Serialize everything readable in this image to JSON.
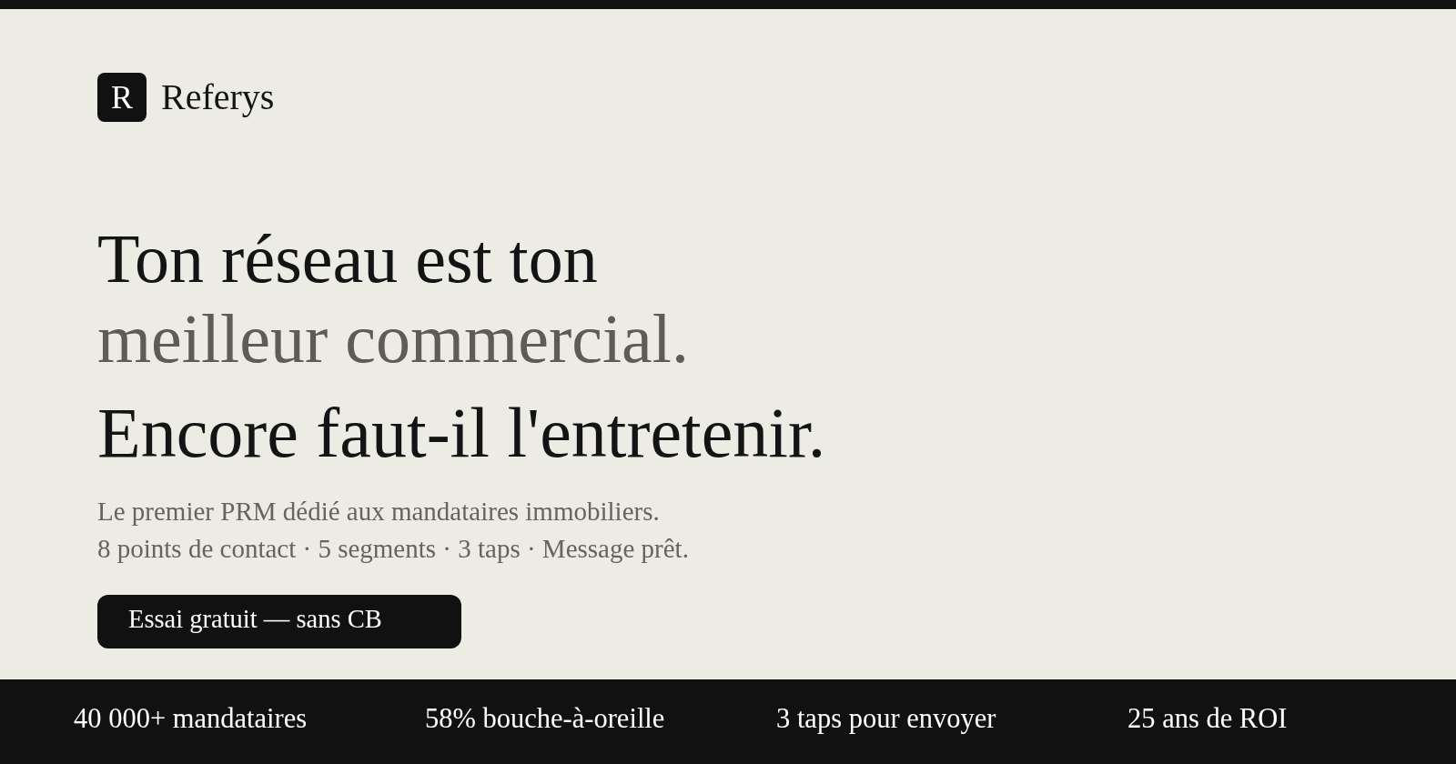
{
  "logo": {
    "mark": "R",
    "name": "Referys"
  },
  "hero": {
    "headline": [
      {
        "text": "Ton réseau est ton",
        "muted": false
      },
      {
        "text": "meilleur commercial.",
        "muted": true
      }
    ],
    "tagline": "Encore faut-il l'entretenir.",
    "description": [
      "Le premier PRM dédié aux mandataires immobiliers.",
      "8 points de contact · 5 segments · 3 taps · Message prêt."
    ],
    "cta": "Essai gratuit — sans CB"
  },
  "stats": [
    "40 000+ mandataires",
    "58% bouche-à-oreille",
    "3 taps pour envoyer",
    "25 ans de ROI"
  ]
}
